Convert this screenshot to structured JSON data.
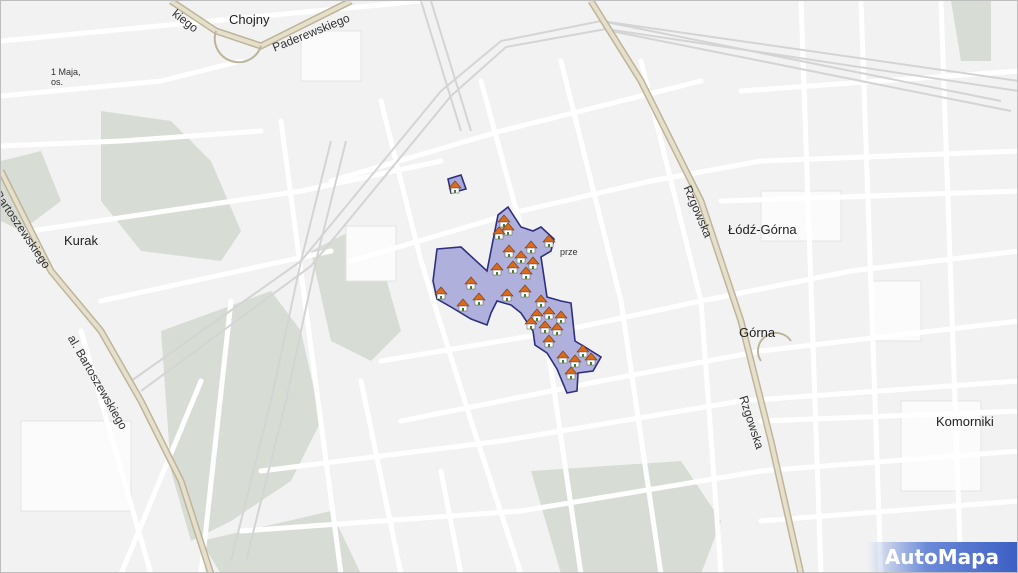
{
  "map": {
    "places": {
      "chojny": "Chojny",
      "maja": "1 Maja,",
      "maja_os": "os.",
      "kurak": "Kurak",
      "lodz_gorna": "Łódź-Górna",
      "gorna": "Górna",
      "komorniki": "Komorniki",
      "prze": "prze"
    },
    "streets": {
      "paderewskiego": "Paderewskiego",
      "kiego_top": "kiego",
      "bartoszewskiego_left": "Bartoszewskiego",
      "bartoszewskiego_al": "al. Bartoszewskiego",
      "rzgowska_north": "Rzgowska",
      "rzgowska_south": "Rzgowska"
    },
    "logo": "AutoMapa",
    "colors": {
      "background": "#f2f2f2",
      "road": "#ffffff",
      "railway": "#d0d0d0",
      "main_road": "#c9c2a8",
      "green": "#d5dcd2",
      "highlight_fill": "#a8a8d8",
      "highlight_stroke": "#3a3a8a",
      "house_roof": "#d96b1e"
    }
  }
}
